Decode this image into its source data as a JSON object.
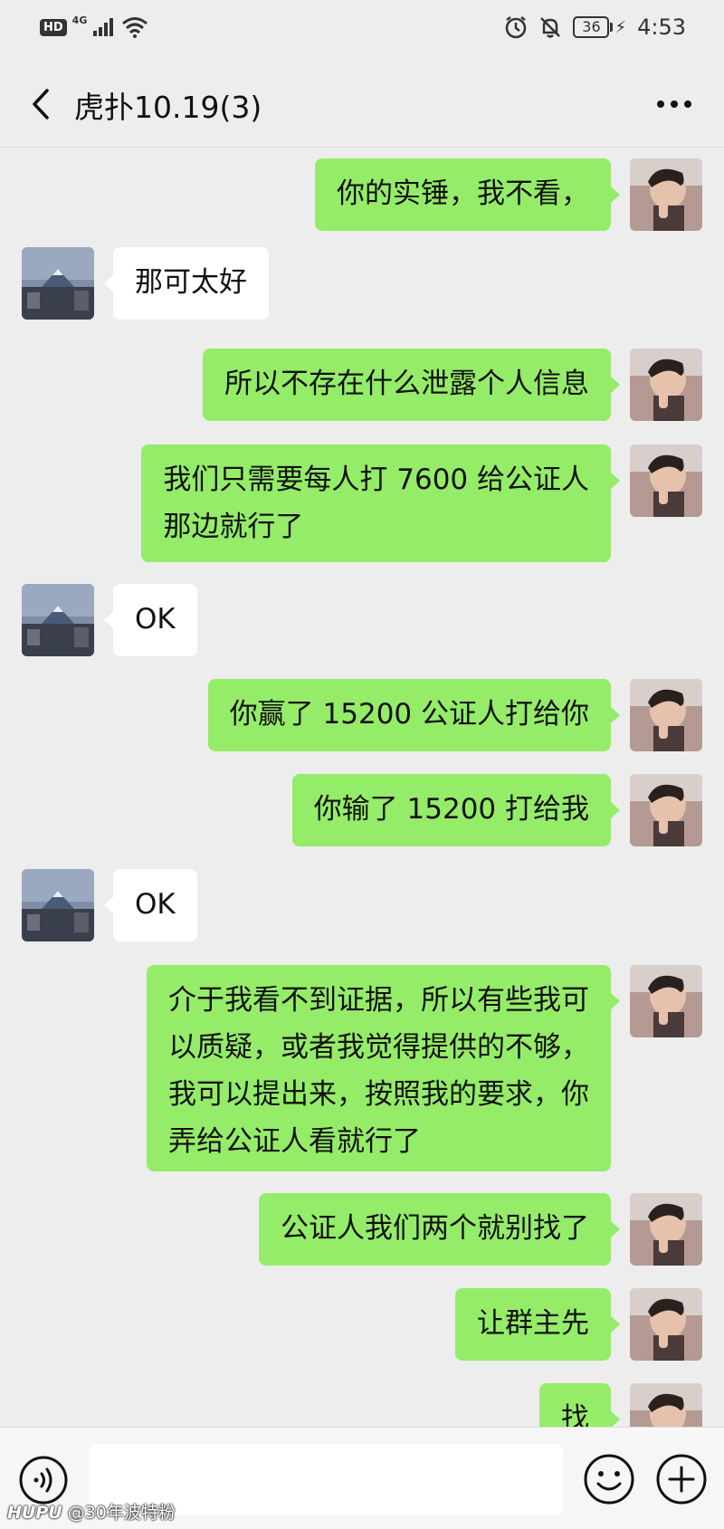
{
  "status_bar": {
    "hd_label": "HD",
    "network_label": "4G",
    "battery_level": "36",
    "time": "4:53",
    "icons": [
      "signal-icon",
      "wifi-icon",
      "alarm-icon",
      "mute-icon",
      "battery-icon",
      "charging-icon"
    ]
  },
  "header": {
    "title": "虎扑10.19(3)",
    "back_icon": "chevron-left-icon",
    "more_icon": "more-dots-icon"
  },
  "colors": {
    "background": "#ededed",
    "my_bubble": "#95ec69",
    "other_bubble": "#ffffff"
  },
  "messages": [
    {
      "sender": "me",
      "text": "你的实锤，我不看，"
    },
    {
      "sender": "other",
      "text": "那可太好"
    },
    {
      "sender": "me",
      "text": "所以不存在什么泄露个人信息"
    },
    {
      "sender": "me",
      "text": "我们只需要每人打 7600 给公证人\n那边就行了"
    },
    {
      "sender": "other",
      "text": "OK"
    },
    {
      "sender": "me",
      "text": "你赢了 15200 公证人打给你"
    },
    {
      "sender": "me",
      "text": "你输了 15200 打给我"
    },
    {
      "sender": "other",
      "text": "OK"
    },
    {
      "sender": "me",
      "text": "介于我看不到证据，所以有些我可\n以质疑，或者我觉得提供的不够，\n我可以提出来，按照我的要求，你\n弄给公证人看就行了"
    },
    {
      "sender": "me",
      "text": "公证人我们两个就别找了"
    },
    {
      "sender": "me",
      "text": "让群主先"
    },
    {
      "sender": "me",
      "text": "找"
    }
  ],
  "input_bar": {
    "input_value": "",
    "voice_icon": "voice-icon",
    "emoji_icon": "emoji-icon",
    "plus_icon": "plus-icon"
  },
  "watermark": {
    "brand": "HUPU",
    "user": "@30年波特粉"
  }
}
